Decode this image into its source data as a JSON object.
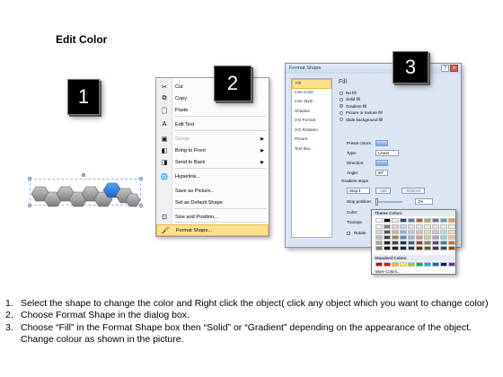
{
  "title": "Edit Color",
  "badges": [
    "1",
    "2",
    "3"
  ],
  "context_menu": {
    "items": [
      {
        "label": "Cut",
        "icon": "scissors-icon",
        "glyph": "✂",
        "disabled": false,
        "submenu": false
      },
      {
        "label": "Copy",
        "icon": "copy-icon",
        "glyph": "⧉",
        "disabled": false,
        "submenu": false
      },
      {
        "label": "Paste",
        "icon": "paste-icon",
        "glyph": "📋",
        "disabled": false,
        "submenu": false
      },
      {
        "label": "Edit Text",
        "icon": "edit-text-icon",
        "glyph": "A",
        "disabled": false,
        "submenu": false
      },
      {
        "label": "Group",
        "icon": "group-icon",
        "glyph": "▣",
        "disabled": true,
        "submenu": true
      },
      {
        "label": "Bring to Front",
        "icon": "bring-front-icon",
        "glyph": "◧",
        "disabled": false,
        "submenu": true
      },
      {
        "label": "Send to Back",
        "icon": "send-back-icon",
        "glyph": "◨",
        "disabled": false,
        "submenu": true
      },
      {
        "label": "Hyperlink...",
        "icon": "hyperlink-icon",
        "glyph": "🌐",
        "disabled": false,
        "submenu": false
      },
      {
        "label": "Save as Picture...",
        "icon": "",
        "glyph": "",
        "disabled": false,
        "submenu": false
      },
      {
        "label": "Set as Default Shape",
        "icon": "",
        "glyph": "",
        "disabled": false,
        "submenu": false
      },
      {
        "label": "Size and Position...",
        "icon": "size-position-icon",
        "glyph": "⊡",
        "disabled": false,
        "submenu": false
      },
      {
        "label": "Format Shape...",
        "icon": "format-shape-icon",
        "glyph": "🖌",
        "disabled": false,
        "submenu": false,
        "highlight": true
      }
    ]
  },
  "dialog": {
    "title": "Format Shape",
    "title_buttons": {
      "help": "?",
      "close": "✕"
    },
    "nav": [
      "Fill",
      "Line Color",
      "Line Style",
      "Shadow",
      "3-D Format",
      "3-D Rotation",
      "Picture",
      "Text Box"
    ],
    "fill_heading": "Fill",
    "fill_options": [
      {
        "label": "No fill",
        "selected": false
      },
      {
        "label": "Solid fill",
        "selected": false
      },
      {
        "label": "Gradient fill",
        "selected": true
      },
      {
        "label": "Picture or texture fill",
        "selected": false
      },
      {
        "label": "Slide background fill",
        "selected": false
      }
    ],
    "preset_colors_label": "Preset colors:",
    "type_label": "Type:",
    "type_value": "Linear",
    "direction_label": "Direction:",
    "angle_label": "Angle:",
    "angle_value": "90°",
    "gradient_stops_label": "Gradient stops",
    "stop_value": "Stop 1",
    "add_label": "Add",
    "remove_label": "Remove",
    "stop_position_label": "Stop position:",
    "stop_position_value": "1%",
    "color_label": "Color:",
    "transparency_label": "Transpa",
    "rotate_label": "Rotate"
  },
  "color_picker": {
    "theme_heading": "Theme Colors",
    "standard_heading": "Standard Colors",
    "more_label": "More Colors...",
    "theme_top": [
      "#ffffff",
      "#000000",
      "#eeece1",
      "#1f497d",
      "#4f81bd",
      "#c0504d",
      "#9bbb59",
      "#8064a2",
      "#4bacc6",
      "#f79646"
    ],
    "theme_shade_columns": [
      [
        "#f2f2f2",
        "#d8d8d8",
        "#bfbfbf",
        "#a5a5a5",
        "#7f7f7f"
      ],
      [
        "#7f7f7f",
        "#595959",
        "#3f3f3f",
        "#262626",
        "#0c0c0c"
      ],
      [
        "#ddd9c3",
        "#c4bd97",
        "#938953",
        "#494429",
        "#1d1b10"
      ],
      [
        "#c6d9f0",
        "#8db3e2",
        "#548dd4",
        "#17365d",
        "#0f243e"
      ],
      [
        "#dbe5f1",
        "#b8cce4",
        "#95b3d7",
        "#366092",
        "#244061"
      ],
      [
        "#f2dcdb",
        "#e5b9b7",
        "#d99694",
        "#953734",
        "#632423"
      ],
      [
        "#ebf1dd",
        "#d7e3bc",
        "#c3d69b",
        "#76923c",
        "#4f6128"
      ],
      [
        "#e5e0ec",
        "#ccc1d9",
        "#b2a2c7",
        "#5f497a",
        "#3f3151"
      ],
      [
        "#dbeef3",
        "#b7dde8",
        "#92cddc",
        "#31859b",
        "#205867"
      ],
      [
        "#fdeada",
        "#fbd5b5",
        "#fac08f",
        "#e36c09",
        "#974806"
      ]
    ],
    "standard": [
      "#c00000",
      "#ff0000",
      "#ffc000",
      "#ffff00",
      "#92d050",
      "#00b050",
      "#00b0f0",
      "#0070c0",
      "#002060",
      "#7030a0"
    ]
  },
  "shape_colors": {
    "gray": "#8c8c8c",
    "gray_light": "#b4b4b4",
    "blue": "#2a7fd4"
  },
  "steps": [
    {
      "num": "1.",
      "text": "Select the shape to change the color and Right click the object( click any object which you want to change color)"
    },
    {
      "num": "2.",
      "text": "Choose Format Shape in the dialog box."
    },
    {
      "num": "3.",
      "text": "Choose “Fill” in the Format Shape box then “Solid” or “Gradient” depending on the appearance of the object. Change colour as shown in the picture."
    }
  ]
}
